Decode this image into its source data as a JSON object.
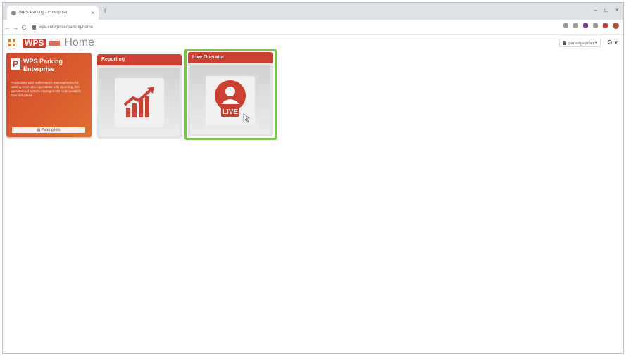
{
  "browser": {
    "tab_title": "WPS Parking - Enterprise",
    "tab_close": "×",
    "new_tab": "+",
    "window_controls": [
      "–",
      "□",
      "×"
    ],
    "nav": [
      "←",
      "→",
      "C"
    ],
    "url": "wps.enterprise/parking/home"
  },
  "app": {
    "logo": "WPS",
    "title": "Home",
    "user_menu": "parkingadmin ▾",
    "settings": "⚙ ▾"
  },
  "tiles": {
    "info": {
      "badge": "P",
      "title": "WPS Parking Enterprise",
      "description": "Productivity and performance improvements for parking enterprise operations with reporting, live operator and system management tools available from one place.",
      "button": "▤ Parking Info"
    },
    "reporting": {
      "label": "Reporting"
    },
    "live_operator": {
      "label": "Live Operator",
      "icon_text": "LIVE"
    }
  },
  "colors": {
    "accent": "#cf3f30",
    "highlight": "#7cc44c",
    "orange": "#e07a1e"
  }
}
